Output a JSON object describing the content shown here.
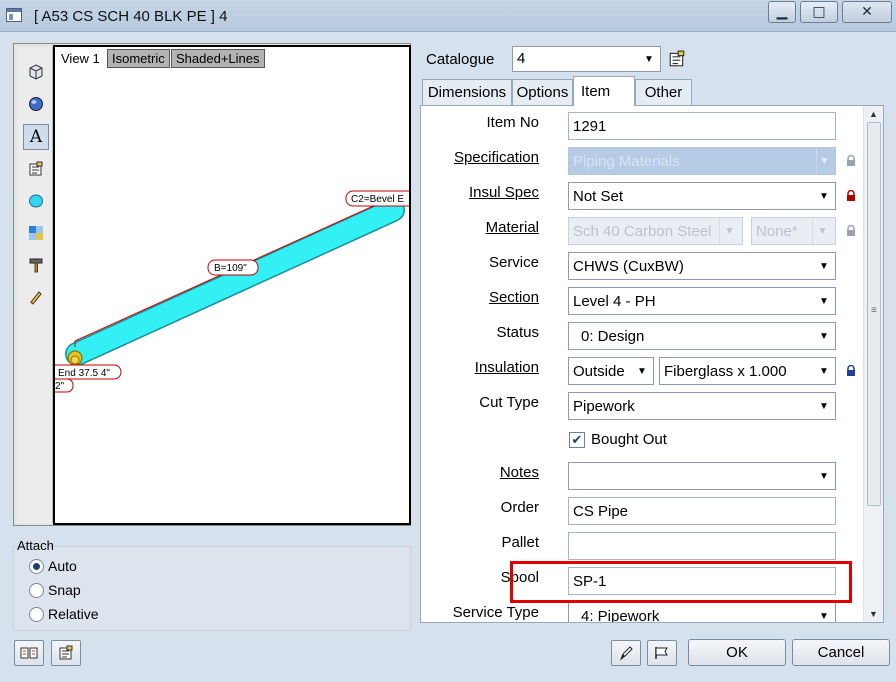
{
  "window": {
    "title": "[ A53 CS SCH 40 BLK PE ]  4",
    "minimize_glyph": "▁",
    "maximize_glyph": "□",
    "close_glyph": "✕"
  },
  "preview": {
    "view_label": "View 1",
    "isometric_button": "Isometric",
    "shaded_button": "Shaded+Lines",
    "dim_c2": "C2=Bevel E",
    "dim_b": "B=109\"",
    "dim_end": "End 37.5 4\"",
    "dim_2": "2\"",
    "pipe_color": "#33f0f5",
    "tools": [
      "cube-icon",
      "sphere-icon",
      "text-icon",
      "properties-icon",
      "ellipse-icon",
      "grid-icon",
      "hammer-icon",
      "paint-icon"
    ]
  },
  "attach": {
    "title": "Attach",
    "options": [
      {
        "label": "Auto",
        "checked": true
      },
      {
        "label": "Snap",
        "checked": false
      },
      {
        "label": "Relative",
        "checked": false
      }
    ]
  },
  "catalogue": {
    "label": "Catalogue",
    "value": "4"
  },
  "tabs": [
    "Dimensions",
    "Options",
    "Item",
    "Other"
  ],
  "active_tab": "Item",
  "fields": {
    "item_no": {
      "label": "Item No",
      "value": "1291"
    },
    "specification": {
      "label": "Specification",
      "value": "Piping Materials"
    },
    "insul_spec": {
      "label": "Insul Spec",
      "value": "Not Set"
    },
    "material": {
      "label": "Material",
      "value": "Sch 40 Carbon Steel",
      "value2": "None*"
    },
    "service": {
      "label": "Service",
      "value": "CHWS (CuxBW)"
    },
    "section": {
      "label": "Section",
      "value": "Level 4 - PH"
    },
    "status": {
      "label": "Status",
      "value": "0: Design"
    },
    "insulation": {
      "label": "Insulation",
      "value": "Outside",
      "value2": "Fiberglass x 1.000"
    },
    "cut_type": {
      "label": "Cut Type",
      "value": "Pipework"
    },
    "bought_out": {
      "label": "Bought Out",
      "checked": true
    },
    "notes": {
      "label": "Notes",
      "value": ""
    },
    "order": {
      "label": "Order",
      "value": "CS Pipe"
    },
    "pallet": {
      "label": "Pallet",
      "value": ""
    },
    "spool": {
      "label": "Spool",
      "value": "SP-1"
    },
    "service_type": {
      "label": "Service Type",
      "value": "4: Pipework"
    }
  },
  "buttons": {
    "ok": "OK",
    "cancel": "Cancel"
  },
  "colors": {
    "highlight": "#e00000",
    "disabled_field": "#b6cbe6",
    "lock_red": "#b00000",
    "lock_blue": "#1d3f9e"
  }
}
